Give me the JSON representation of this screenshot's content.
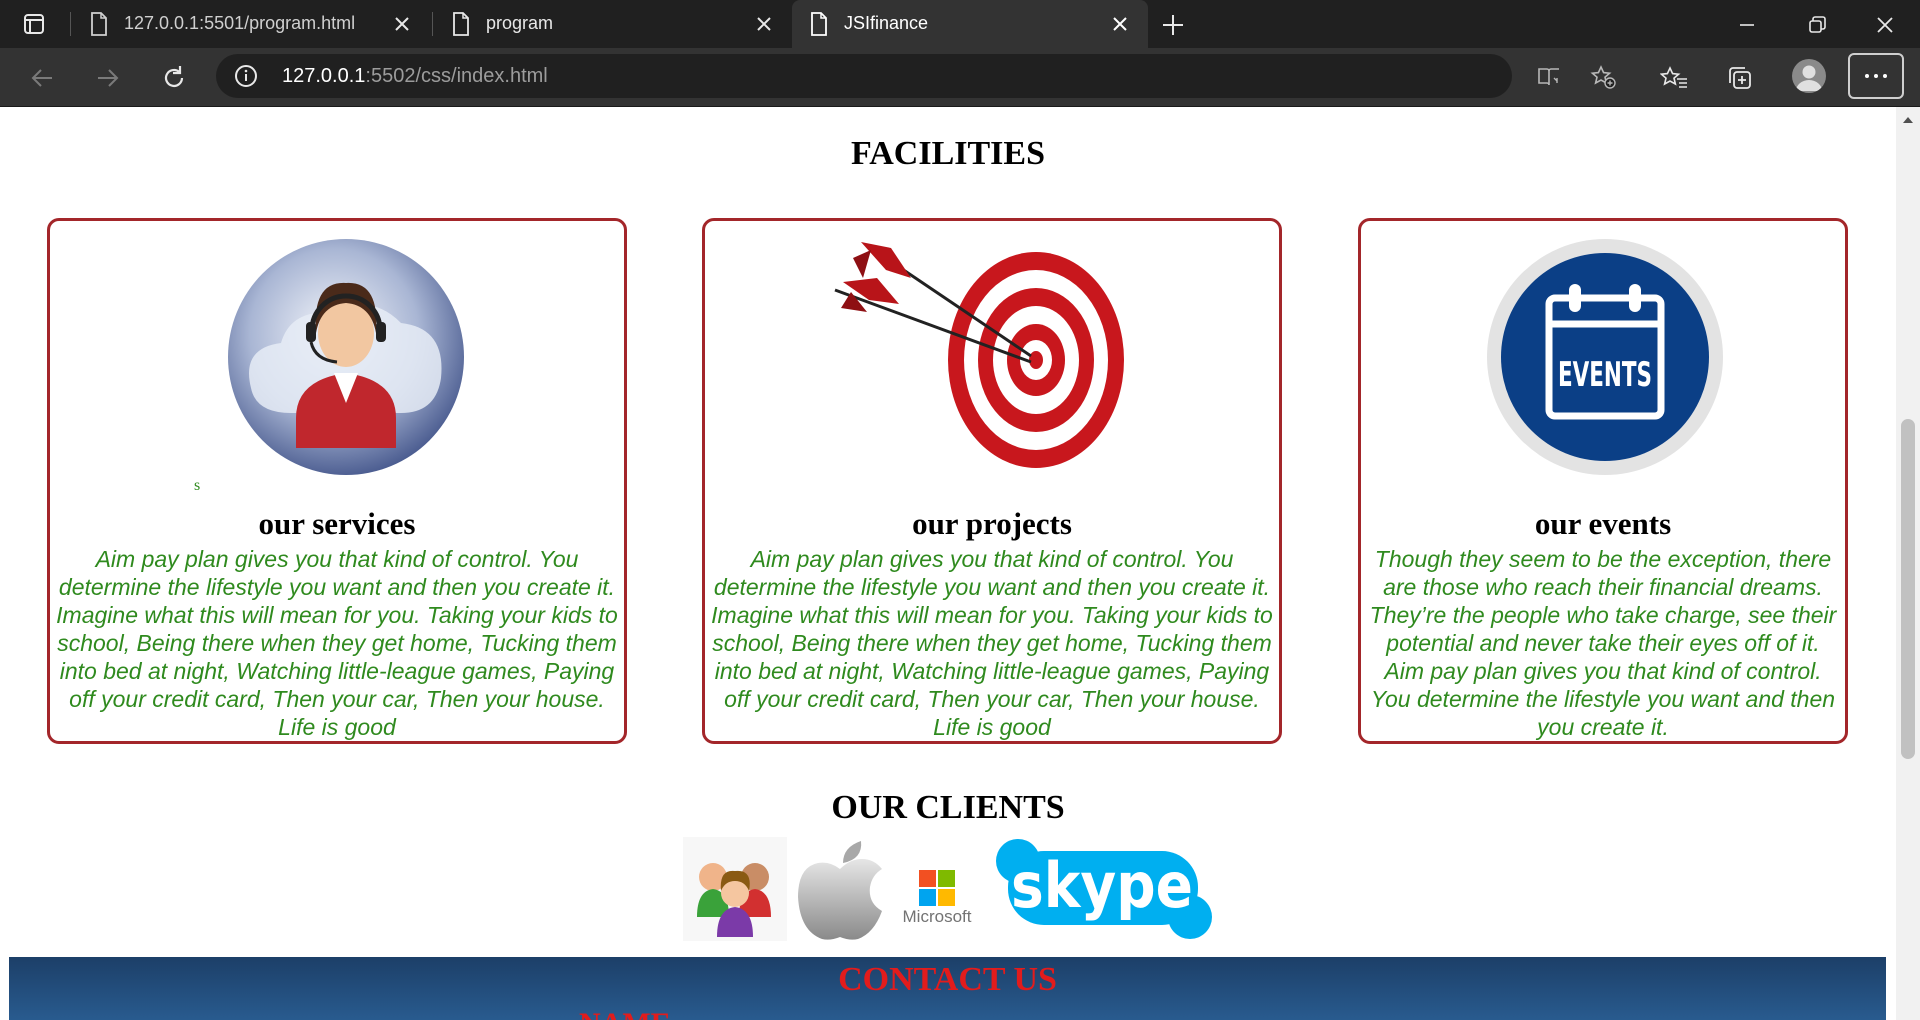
{
  "browser": {
    "tabs": [
      {
        "title": "127.0.0.1:5501/program.html",
        "active": false
      },
      {
        "title": "program",
        "active": false
      },
      {
        "title": "JSIfinance",
        "active": true
      }
    ],
    "url_host": "127.0.0.1",
    "url_rest": ":5502/css/index.html",
    "icons": {
      "tab_actions": "tab-actions-icon",
      "page": "page-icon",
      "close": "close-icon",
      "new_tab": "plus-icon",
      "minimize": "minimize-icon",
      "restore": "restore-icon",
      "window_close": "window-close-icon",
      "back": "back-arrow-icon",
      "forward": "forward-arrow-icon",
      "refresh": "refresh-icon",
      "site_info": "info-icon",
      "reader": "immersive-reader-icon",
      "add_favorite": "star-plus-icon",
      "favorites": "favorites-icon",
      "collections": "collections-icon",
      "profile": "profile-avatar-icon",
      "menu": "more-dots-icon"
    }
  },
  "page": {
    "facilities_title": "FACILITIES",
    "cards": [
      {
        "image": "call-center-agent-icon",
        "title": "our services",
        "text": "Aim pay plan gives you that kind of control. You determine the lifestyle you want and then you create it. Imagine what this will mean for you. Taking your kids to school, Being there when they get home, Tucking them into bed at night, Watching little-league games, Paying off your credit card, Then your car, Then your house. Life is good"
      },
      {
        "image": "target-with-arrows-icon",
        "title": "our projects",
        "text": "Aim pay plan gives you that kind of control. You determine the lifestyle you want and then you create it. Imagine what this will mean for you. Taking your kids to school, Being there when they get home, Tucking them into bed at night, Watching little-league games, Paying off your credit card, Then your car, Then your house. Life is good"
      },
      {
        "image": "events-calendar-icon",
        "image_label": "EVENTS",
        "title": "our events",
        "text": "Though they seem to be the exception, there are those who reach their financial dreams. They’re the people who take charge, see their potential and never take their eyes off of it. Aim pay plan gives you that kind of control. You determine the lifestyle you want and then you create it."
      }
    ],
    "stray_text": "s",
    "clients_title": "OUR CLIENTS",
    "clients": [
      {
        "name": "people-group-logo"
      },
      {
        "name": "apple-logo"
      },
      {
        "name": "microsoft-logo",
        "label": "Microsoft"
      },
      {
        "name": "skype-logo",
        "label": "skype"
      }
    ],
    "contact_title": "CONTACT US",
    "name_label": "NAME"
  },
  "colors": {
    "card_border": "#a3262a",
    "card_text": "#2f8a1e",
    "contact_title": "#e21c1c",
    "contact_bg": "#1c3f68",
    "chrome_dark": "#202020",
    "chrome_toolbar": "#333333"
  }
}
